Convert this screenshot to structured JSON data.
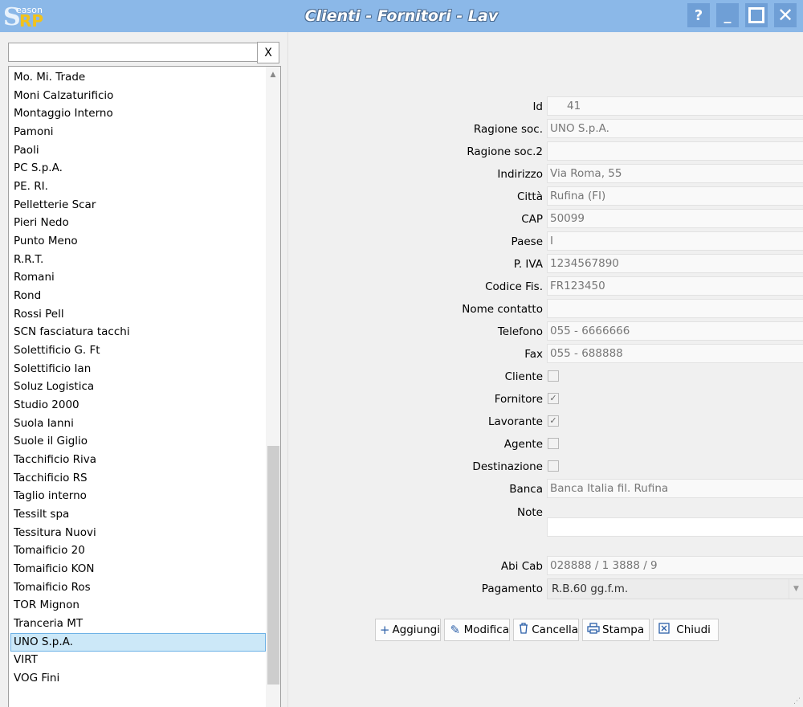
{
  "window": {
    "logo_letters": "S",
    "logo_rp": "RP",
    "logo_small": "eason",
    "title": "Clienti - Fornitori - Lav",
    "help_icon": "?",
    "minimize_icon": "_",
    "close_icon": "✕"
  },
  "search": {
    "value": "",
    "clear_label": "X"
  },
  "list": {
    "items": [
      "Mo. Mi. Trade",
      "Moni Calzaturificio",
      "Montaggio Interno",
      "Pamoni",
      "Paoli",
      "PC S.p.A.",
      "PE. RI.",
      "Pelletterie Scar",
      "Pieri Nedo",
      "Punto Meno",
      "R.R.T.",
      "Romani",
      "Rond",
      "Rossi Pell",
      "SCN fasciatura tacchi",
      "Solettificio G. Ft",
      "Solettificio Ian",
      "Soluz Logistica",
      "Studio 2000",
      "Suola Ianni",
      "Suole il Giglio",
      "Tacchificio Riva",
      "Tacchificio RS",
      "Taglio interno",
      "Tessilt spa",
      "Tessitura Nuovi",
      "Tomaificio 20",
      "Tomaificio KON",
      "Tomaificio Ros",
      "TOR Mignon",
      "Tranceria MT",
      "UNO S.p.A.",
      "VIRT",
      "VOG Fini"
    ],
    "selected": "UNO S.p.A."
  },
  "form": {
    "id_label": "Id",
    "id_value": "41",
    "ragione_label": "Ragione soc.",
    "ragione_value": "UNO S.p.A.",
    "ragione2_label": "Ragione soc.2",
    "ragione2_value": "",
    "indirizzo_label": "Indirizzo",
    "indirizzo_value": "Via Roma, 55",
    "citta_label": "Città",
    "citta_value": "Rufina (FI)",
    "cap_label": "CAP",
    "cap_value": "50099",
    "paese_label": "Paese",
    "paese_value": "I",
    "piva_label": "P. IVA",
    "piva_value": "1234567890",
    "codfis_label": "Codice Fis.",
    "codfis_value": "FR123450",
    "contatto_label": "Nome contatto",
    "contatto_value": "",
    "telefono_label": "Telefono",
    "telefono_value": "055 - 6666666",
    "fax_label": "Fax",
    "fax_value": "055 - 688888",
    "cliente_label": "Cliente",
    "cliente_checked": false,
    "fornitore_label": "Fornitore",
    "fornitore_checked": true,
    "lavorante_label": "Lavorante",
    "lavorante_checked": true,
    "agente_label": "Agente",
    "agente_checked": false,
    "destinazione_label": "Destinazione",
    "destinazione_checked": false,
    "banca_label": "Banca",
    "banca_value": "Banca Italia fil. Rufina",
    "note_label": "Note",
    "note_value": "",
    "abicab_label": "Abi Cab",
    "abicab_value": "028888 / 1  3888 / 9",
    "pagamento_label": "Pagamento",
    "pagamento_value": "R.B.60 gg.f.m."
  },
  "buttons": {
    "aggiungi": "Aggiungi",
    "modifica": "Modifica",
    "cancella": "Cancella",
    "stampa": "Stampa",
    "chiudi": "Chiudi"
  }
}
